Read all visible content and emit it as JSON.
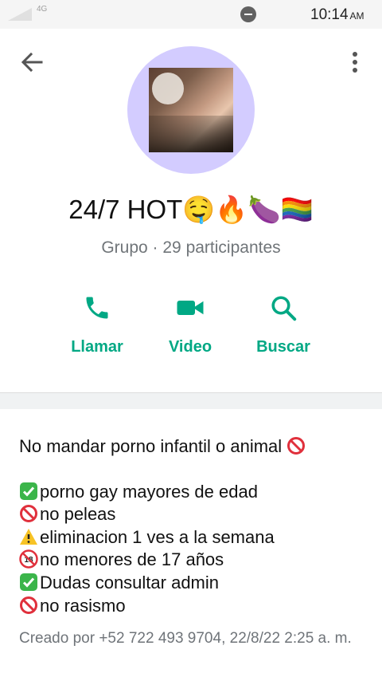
{
  "status_bar": {
    "network": "4G",
    "time": "10:14",
    "ampm": "AM"
  },
  "header": {
    "title": "24/7 HOT🤤🔥🍆🏳️‍🌈",
    "subtitle": "Grupo · 29 participantes"
  },
  "actions": [
    {
      "label": "Llamar",
      "icon": "phone-icon"
    },
    {
      "label": "Video",
      "icon": "video-icon"
    },
    {
      "label": "Buscar",
      "icon": "search-icon"
    }
  ],
  "colors": {
    "accent": "#00a884",
    "avatar_bg": "#d3ccff",
    "subtitle": "#707579"
  },
  "description": {
    "first_line": "No mandar porno infantil o animal",
    "rules": [
      {
        "icon": "check-icon",
        "text": "porno gay mayores de edad"
      },
      {
        "icon": "prohibited-icon",
        "text": "no peleas"
      },
      {
        "icon": "warning-icon",
        "text": "eliminacion 1 ves a la semana"
      },
      {
        "icon": "no-under-18-icon",
        "text": "no menores de 17 años"
      },
      {
        "icon": "check-icon",
        "text": "Dudas consultar admin"
      },
      {
        "icon": "prohibited-icon",
        "text": "no rasismo"
      }
    ]
  },
  "created_text": "Creado por +52 722 493 9704, 22/8/22 2:25 a. m."
}
